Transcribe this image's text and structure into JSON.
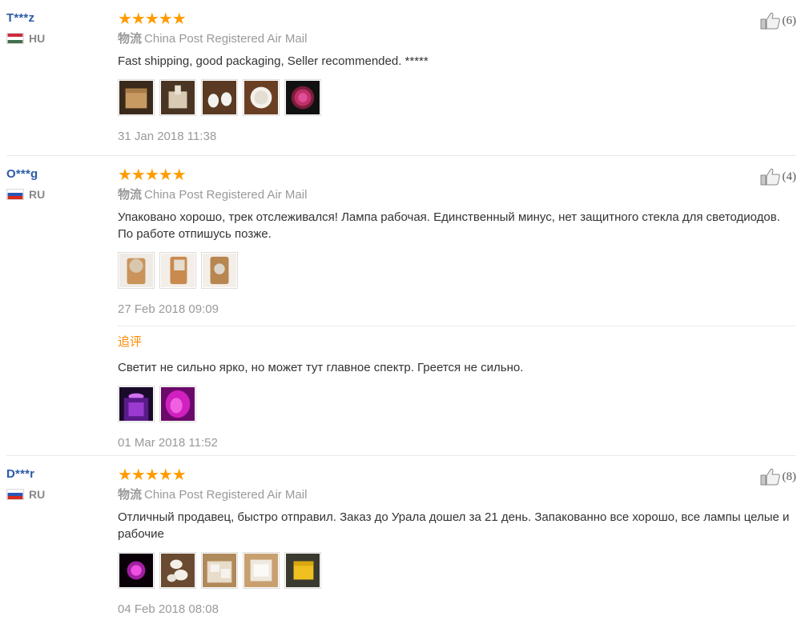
{
  "reviews": [
    {
      "user": "T***z",
      "country": "HU",
      "stars": "★★★★★",
      "shipping_cn": "物流",
      "shipping_method": "China Post Registered Air Mail",
      "text": "Fast shipping, good packaging, Seller recommended. *****",
      "helpful": "(6)",
      "date": "31 Jan 2018 11:38"
    },
    {
      "user": "O***g",
      "country": "RU",
      "stars": "★★★★★",
      "shipping_cn": "物流",
      "shipping_method": "China Post Registered Air Mail",
      "text": "Упаковано хорошо, трек отслеживался! Лампа рабочая. Единственный минус, нет защитного стекла для светодиодов. По работе отпишусь позже.",
      "helpful": "(4)",
      "date": "27 Feb 2018 09:09",
      "followup": {
        "label": "追评",
        "text": "Светит не сильно ярко, но может тут главное спектр. Греется не сильно.",
        "date": "01 Mar 2018 11:52"
      }
    },
    {
      "user": "D***r",
      "country": "RU",
      "stars": "★★★★★",
      "shipping_cn": "物流",
      "shipping_method": "China Post Registered Air Mail",
      "text": "Отличный продавец, быстро отправил. Заказ до Урала дошел за 21 день. Запакованно все хорошо, все лампы целые и рабочие",
      "helpful": "(8)",
      "date": "04 Feb 2018 08:08"
    }
  ],
  "colors": {
    "username": "#2b5ba8",
    "stars": "#ff9c00",
    "followup_label": "#ff8a00",
    "meta_text": "#999999"
  }
}
